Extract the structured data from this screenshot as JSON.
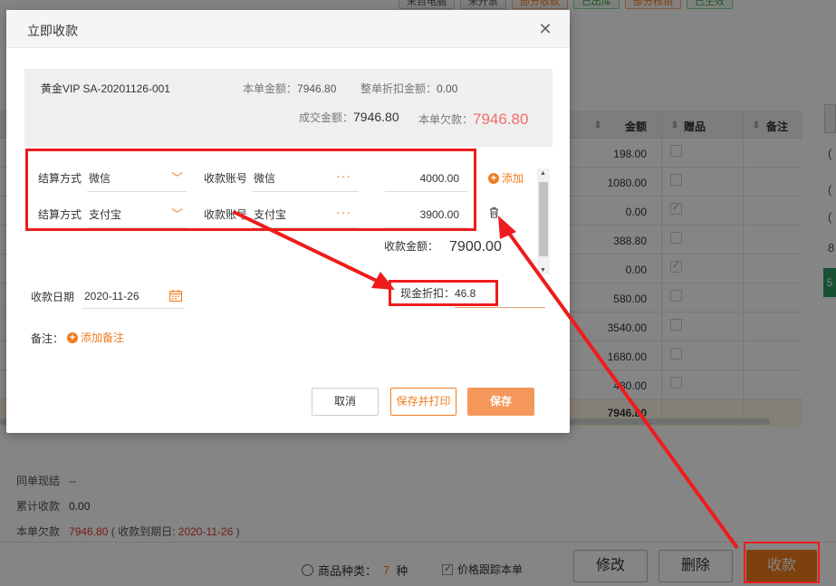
{
  "background": {
    "top_tags": [
      {
        "label": "来自电脑",
        "tone": "gray"
      },
      {
        "label": "未开票",
        "tone": "gray"
      },
      {
        "label": "部分收款",
        "tone": "orange"
      },
      {
        "label": "已出库",
        "tone": "green"
      },
      {
        "label": "部分核销",
        "tone": "orange"
      },
      {
        "label": "已生效",
        "tone": "green"
      }
    ],
    "table": {
      "col_amount": "金额",
      "col_gift": "赠品",
      "col_note": "备注",
      "rows": [
        {
          "amount": "198.00",
          "gift": false
        },
        {
          "amount": "1080.00",
          "gift": false
        },
        {
          "amount": "0.00",
          "gift": true
        },
        {
          "amount": "388.80",
          "gift": false
        },
        {
          "amount": "0.00",
          "gift": true
        },
        {
          "amount": "580.00",
          "gift": false
        },
        {
          "amount": "3540.00",
          "gift": false
        },
        {
          "amount": "1680.00",
          "gift": false
        },
        {
          "amount": "480.00",
          "gift": false
        }
      ],
      "total": "7946.80"
    },
    "summary": {
      "same_order_label": "同单现结",
      "same_order_value": "--",
      "accum_label": "累计收款",
      "accum_value": "0.00",
      "owe_label": "本单欠款",
      "owe_value": "7946.80",
      "due_prefix": "( 收款到期日:",
      "due_date": "2020-11-26",
      "due_suffix": ")"
    },
    "bottom_bar": {
      "kinds_label": "商品种类：",
      "kinds_count": "7",
      "kinds_unit": "种",
      "track_label": "价格跟踪本单",
      "edit_button": "修改",
      "delete_button": "删除",
      "collect_button": "收款"
    }
  },
  "modal": {
    "title": "立即收款",
    "info": {
      "order": "黄金VIP SA-20201126-001",
      "total_label": "本单金额：",
      "total_value": "7946.80",
      "discount_label": "整单折扣金额：",
      "discount_value": "0.00",
      "deal_label": "成交金额：",
      "deal_value": "7946.80",
      "owe_label": "本单欠款：",
      "owe_value": "7946.80"
    },
    "payments": [
      {
        "method_label": "结算方式",
        "method": "微信",
        "account_label": "收款账号",
        "account": "微信",
        "amount": "4000.00"
      },
      {
        "method_label": "结算方式",
        "method": "支付宝",
        "account_label": "收款账号",
        "account": "支付宝",
        "amount": "3900.00"
      }
    ],
    "add_label": "添加",
    "received_label": "收款金额：",
    "received_value": "7900.00",
    "date_label": "收款日期",
    "date_value": "2020-11-26",
    "cash_discount": "现金折扣：46.8",
    "note_label": "备注：",
    "add_note_label": "添加备注",
    "cancel_button": "取消",
    "save_print_button": "保存并打印",
    "save_button": "保存"
  },
  "colors": {
    "accent": "#f07c1e",
    "annotation": "#ee1c1c",
    "owe_red": "#f56c6c"
  }
}
